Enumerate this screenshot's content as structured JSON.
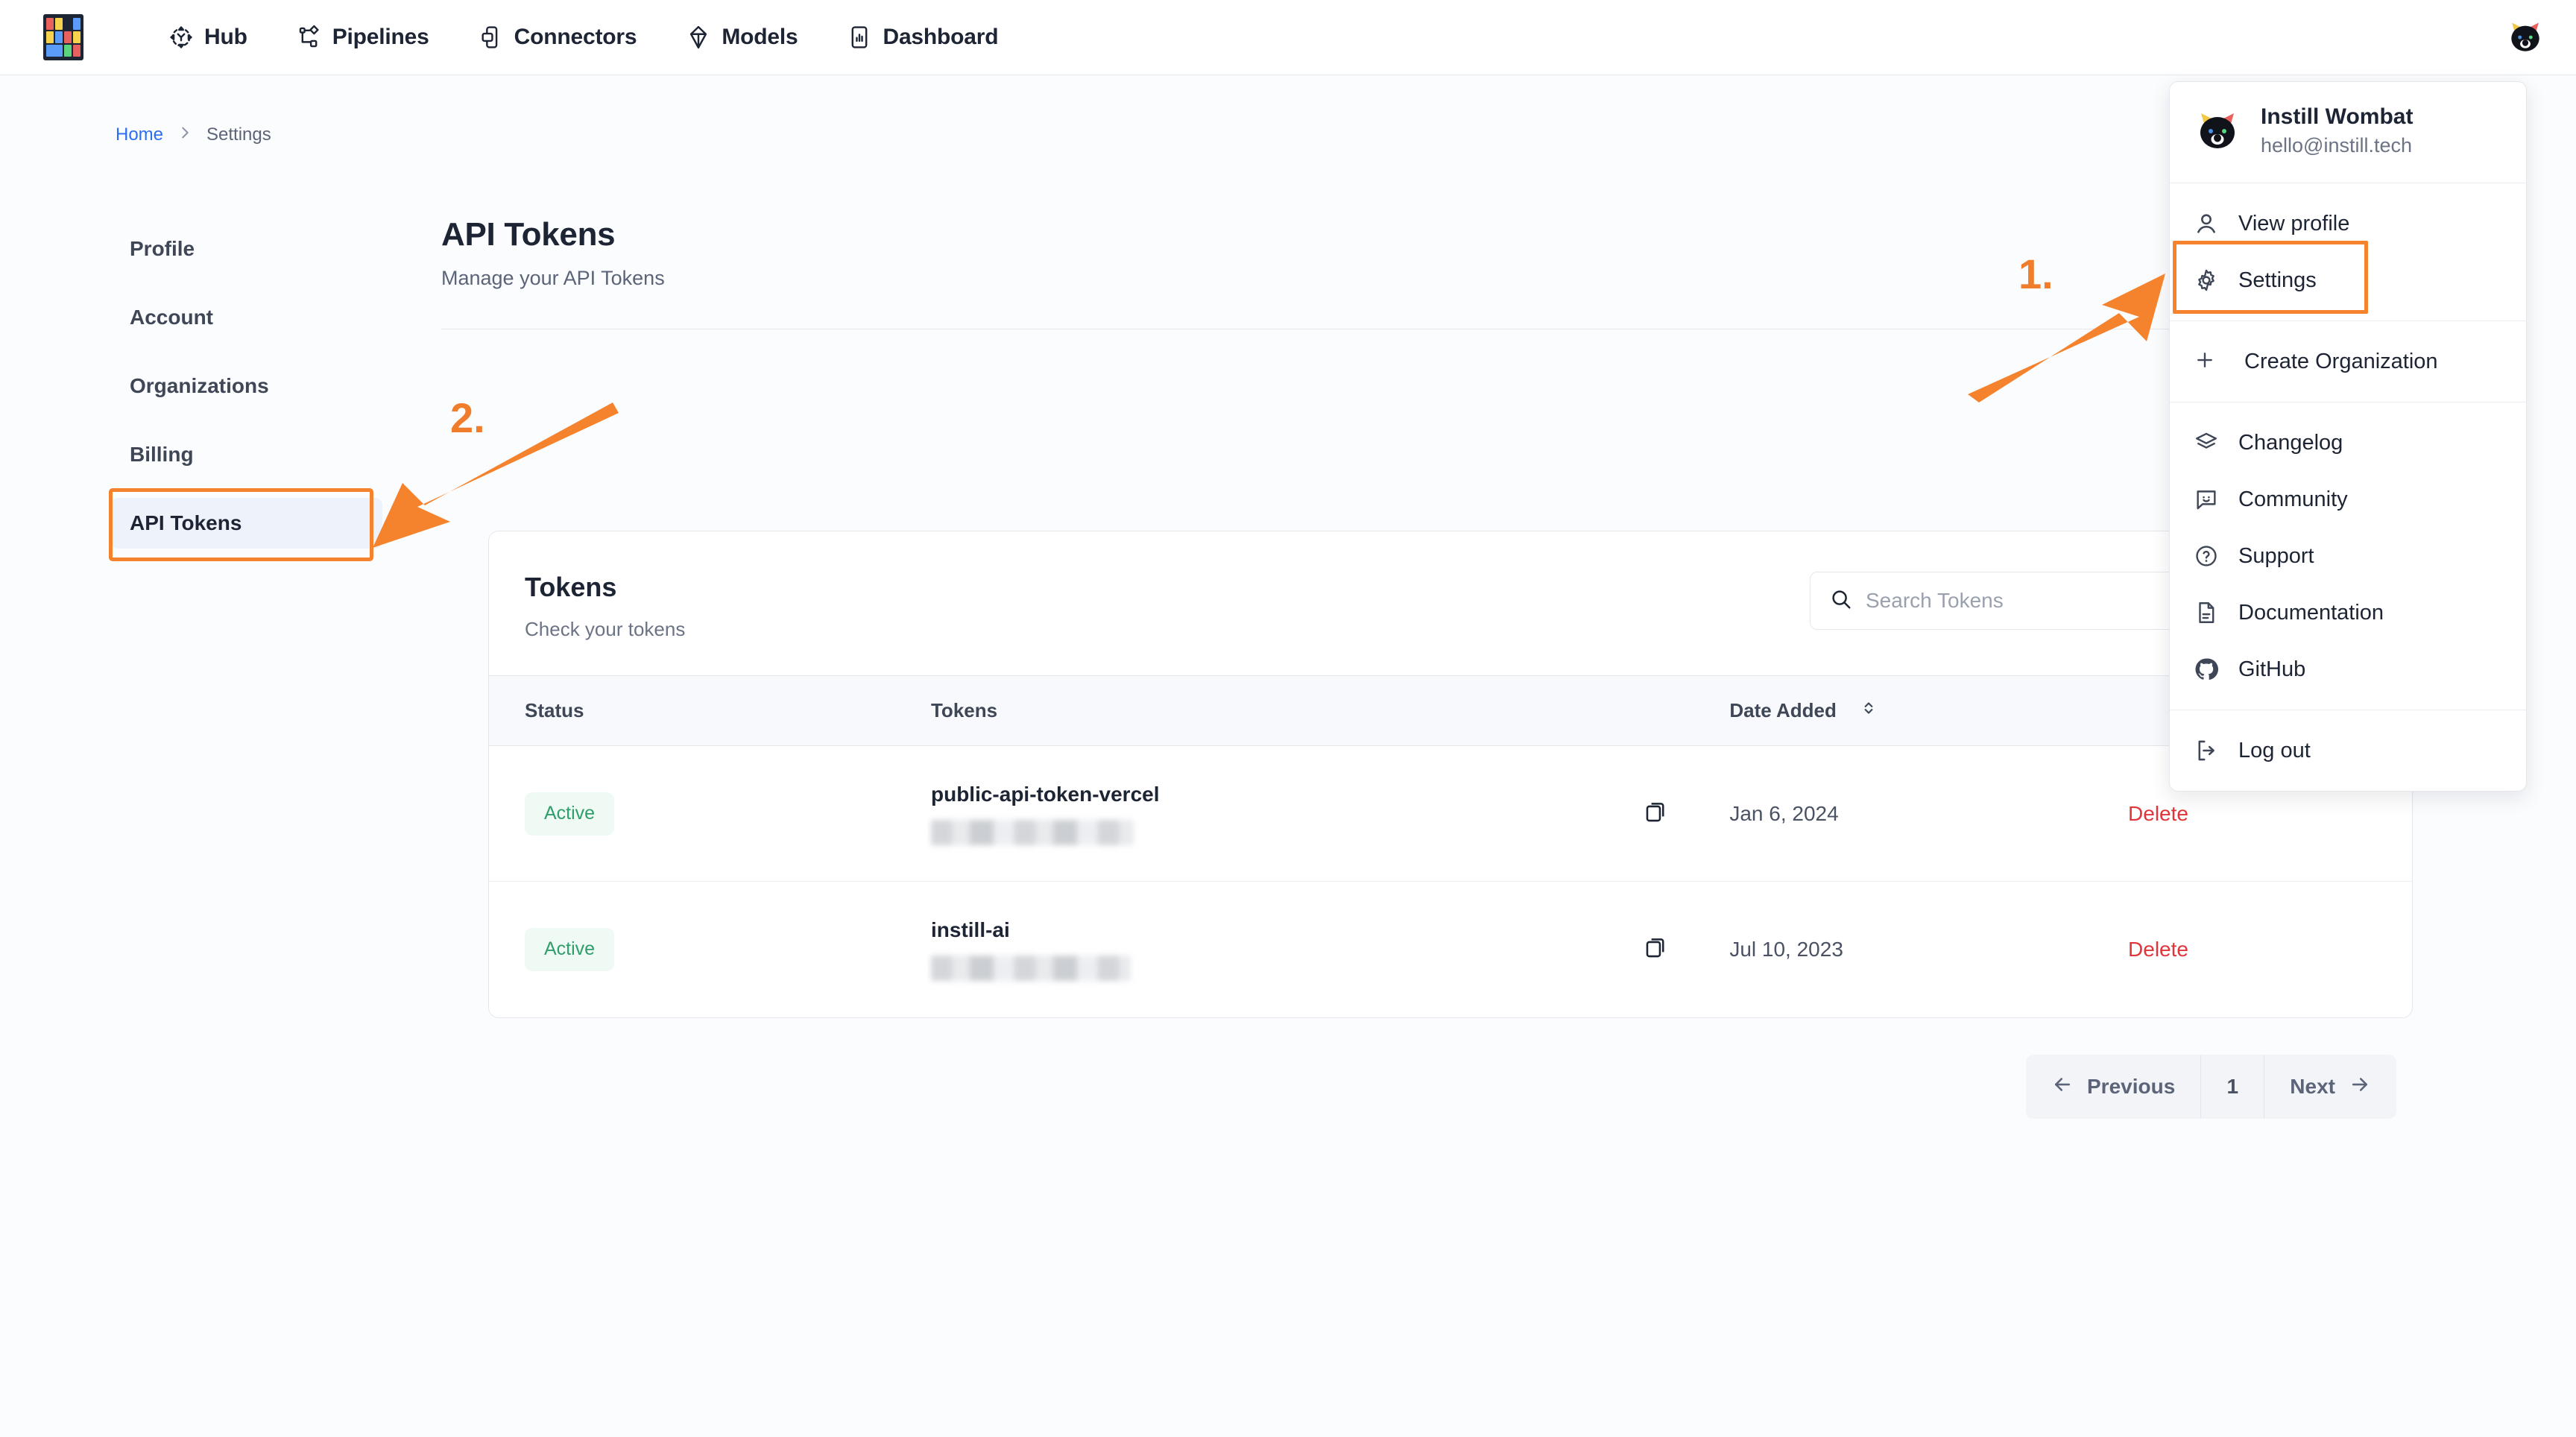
{
  "nav": {
    "logo_name": "instill-logo",
    "logo_tiles": [
      {
        "color": "#e8615f"
      },
      {
        "color": "#f7d койот"
      },
      {
        "color": ""
      },
      {
        "color": "#5b9cf8"
      }
    ],
    "items": [
      {
        "label": "Hub",
        "icon": "hub-icon"
      },
      {
        "label": "Pipelines",
        "icon": "pipelines-icon"
      },
      {
        "label": "Connectors",
        "icon": "connectors-icon"
      },
      {
        "label": "Models",
        "icon": "models-icon"
      },
      {
        "label": "Dashboard",
        "icon": "dashboard-icon"
      }
    ],
    "avatar_alt": "Instill Wombat avatar"
  },
  "breadcrumb": {
    "home": "Home",
    "separator": "›",
    "current": "Settings"
  },
  "sidebar": {
    "items": [
      {
        "label": "Profile",
        "active": false
      },
      {
        "label": "Account",
        "active": false
      },
      {
        "label": "Organizations",
        "active": false
      },
      {
        "label": "Billing",
        "active": false
      },
      {
        "label": "API Tokens",
        "active": true
      }
    ]
  },
  "main": {
    "title": "API Tokens",
    "subtitle": "Manage your API Tokens"
  },
  "card": {
    "title": "Tokens",
    "subtitle": "Check your tokens",
    "search": {
      "value": "",
      "placeholder": "Search Tokens"
    },
    "columns": [
      "Status",
      "Tokens",
      "",
      "Date Added",
      ""
    ],
    "rows": [
      {
        "status": "Active",
        "token_name": "public-api-token-vercel",
        "token_value": "",
        "date_added": "Jan 6, 2024",
        "action": "Delete"
      },
      {
        "status": "Active",
        "token_name": "instill-ai",
        "token_value": "",
        "date_added": "Jul 10, 2023",
        "action": "Delete"
      }
    ],
    "pagination": {
      "previous": "Previous",
      "page": "1",
      "next": "Next"
    }
  },
  "menu": {
    "user": {
      "name": "Instill Wombat",
      "email": "hello@instill.tech"
    },
    "groups": [
      [
        {
          "label": "View profile",
          "icon": "user-icon"
        },
        {
          "label": "Settings",
          "icon": "gear-icon",
          "highlighted": true
        }
      ],
      [
        {
          "label": "Create Organization",
          "icon": "plus-icon"
        }
      ],
      [
        {
          "label": "Changelog",
          "icon": "layers-icon"
        },
        {
          "label": "Community",
          "icon": "chat-smile-icon"
        },
        {
          "label": "Support",
          "icon": "question-circle-icon"
        },
        {
          "label": "Documentation",
          "icon": "document-icon"
        },
        {
          "label": "GitHub",
          "icon": "github-icon"
        }
      ],
      [
        {
          "label": "Log out",
          "icon": "logout-icon"
        }
      ]
    ]
  },
  "annotations": {
    "step_one": "1.",
    "step_two": "2.",
    "accent_color": "#f5822c"
  }
}
